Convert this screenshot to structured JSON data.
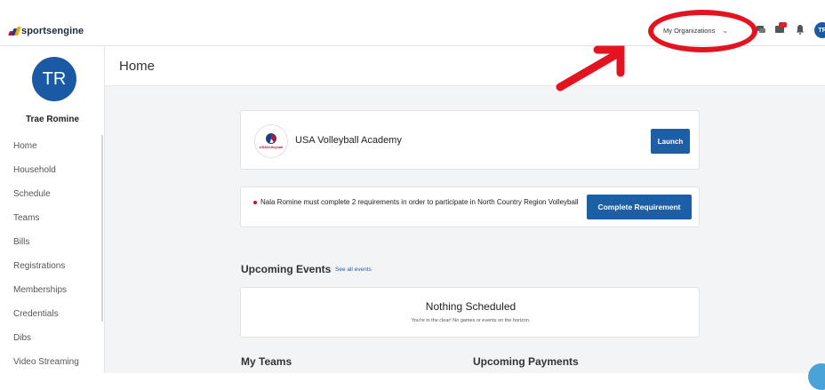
{
  "brand": {
    "logo_text": "sportsengine",
    "mark_colors": [
      "#c8102e",
      "#1b3f8f",
      "#f2a900"
    ]
  },
  "topbar": {
    "org_dropdown_label": "My Organizations",
    "avatar_initials": "TR",
    "icons": [
      "chat-icon",
      "message-badge-icon",
      "bell-icon"
    ],
    "annotation_color": "#e3141f"
  },
  "sidebar": {
    "avatar_initials": "TR",
    "user_name": "Trae Romine",
    "items": [
      {
        "label": "Home"
      },
      {
        "label": "Household"
      },
      {
        "label": "Schedule"
      },
      {
        "label": "Teams"
      },
      {
        "label": "Bills"
      },
      {
        "label": "Registrations"
      },
      {
        "label": "Memberships"
      },
      {
        "label": "Credentials"
      },
      {
        "label": "Dibs"
      },
      {
        "label": "Video Streaming"
      }
    ]
  },
  "main": {
    "page_title": "Home",
    "academy": {
      "logo_text": "USAVolleyball",
      "name": "USA Volleyball Academy",
      "launch_label": "Launch"
    },
    "requirement": {
      "text": "Nala Romine must complete 2 requirements in order to participate in North Country Region Volleyball",
      "button_label": "Complete Requirement"
    },
    "upcoming_events": {
      "title": "Upcoming Events",
      "see_all": "See all events",
      "empty_title": "Nothing Scheduled",
      "empty_subtitle": "You're in the clear! No games or events on the horizon."
    },
    "my_teams_title": "My Teams",
    "upcoming_payments_title": "Upcoming Payments"
  },
  "colors": {
    "accent": "#1d5fa6",
    "background": "#f3f4f6"
  }
}
